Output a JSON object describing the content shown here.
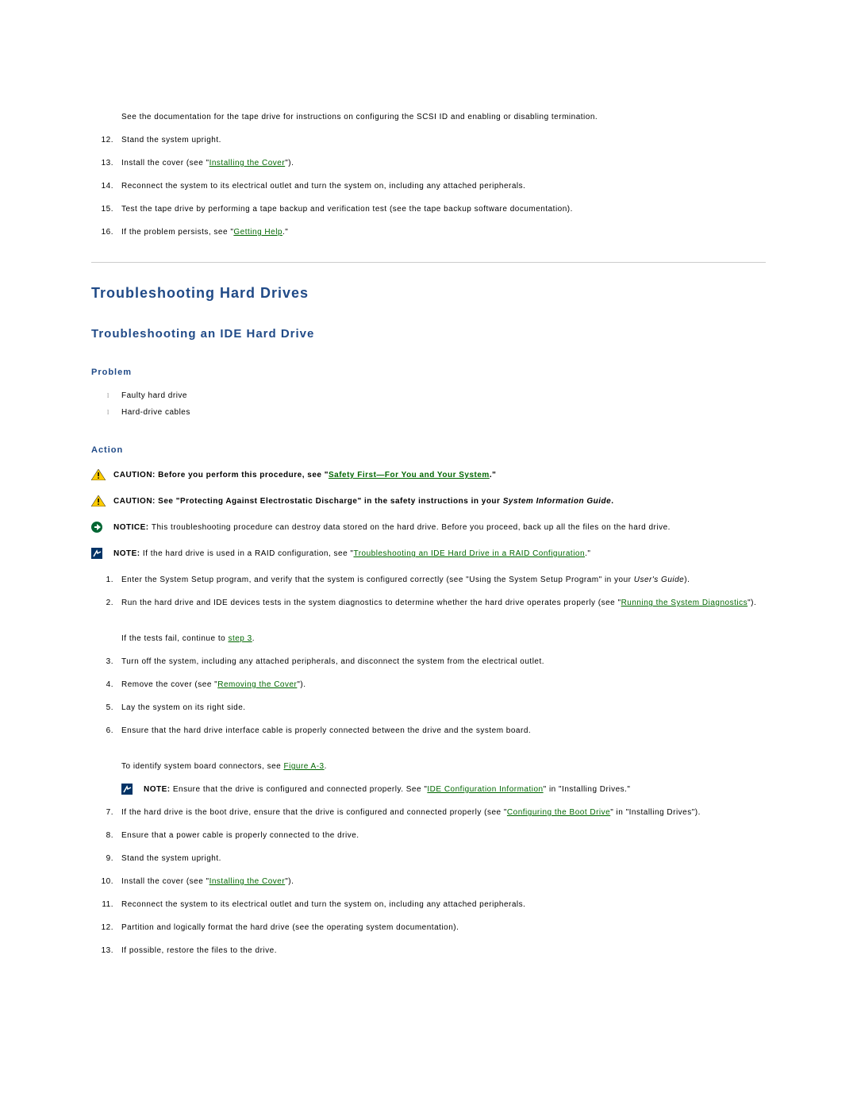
{
  "topSteps": {
    "intro": "See the documentation for the tape drive for instructions on configuring the SCSI ID and enabling or disabling termination.",
    "items": [
      {
        "n": "12.",
        "pre": "Stand the system upright."
      },
      {
        "n": "13.",
        "pre": "Install the cover (see \"",
        "link": "Installing the Cover",
        "post": "\")."
      },
      {
        "n": "14.",
        "pre": "Reconnect the system to its electrical outlet and turn the system on, including any attached peripherals."
      },
      {
        "n": "15.",
        "pre": "Test the tape drive by performing a tape backup and verification test (see the tape backup software documentation)."
      },
      {
        "n": "16.",
        "pre": "If the problem persists, see \"",
        "link": "Getting Help",
        "post": ".\""
      }
    ]
  },
  "heading1": "Troubleshooting Hard Drives",
  "heading2": "Troubleshooting an IDE Hard Drive",
  "problemHead": "Problem",
  "problemBullets": [
    "Faulty hard drive",
    "Hard-drive cables"
  ],
  "actionHead": "Action",
  "callouts": [
    {
      "icon": "triangle",
      "lead": "CAUTION: ",
      "pre": "Before you perform this procedure, see \"",
      "link": "Safety First—For You and Your System",
      "post": ".\"",
      "bold": true
    },
    {
      "icon": "triangle",
      "lead": "CAUTION: ",
      "pre": "See \"Protecting Against Electrostatic Discharge\" in the safety instructions in your ",
      "italic": "System Information Guide",
      "post": ".",
      "bold": true
    },
    {
      "icon": "circle",
      "lead": "NOTICE: ",
      "pre": "This troubleshooting procedure can destroy data stored on the hard drive. Before you proceed, back up all the files on the hard drive."
    },
    {
      "icon": "square",
      "lead": "NOTE: ",
      "pre": "If the hard drive is used in a RAID configuration, see \"",
      "link": "Troubleshooting an IDE Hard Drive in a RAID Configuration",
      "post": ".\""
    }
  ],
  "actionSteps": {
    "s1_n": "1.",
    "s1_pre": "Enter the System Setup program, and verify that the system is configured correctly (see \"Using the System Setup Program\" in your ",
    "s1_italic": "User's Guide",
    "s1_post": ").",
    "s2_n": "2.",
    "s2_pre": "Run the hard drive and IDE devices tests in the system diagnostics to determine whether the hard drive operates properly (see \"",
    "s2_link": "Running the System Diagnostics",
    "s2_post": "\").",
    "interA_pre": "If the tests fail, continue to ",
    "interA_link": "step 3",
    "interA_post": ".",
    "s3_n": "3.",
    "s3_pre": "Turn off the system, including any attached peripherals, and disconnect the system from the electrical outlet.",
    "s4_n": "4.",
    "s4_pre": "Remove the cover (see \"",
    "s4_link": "Removing the Cover",
    "s4_post": "\").",
    "s5_n": "5.",
    "s5_pre": "Lay the system on its right side.",
    "s6_n": "6.",
    "s6_pre": "Ensure that the hard drive interface cable is properly connected between the drive and the system board.",
    "interB_pre": "To identify system board connectors, see ",
    "interB_link": "Figure A-3",
    "interB_post": ".",
    "nestedNote_lead": "NOTE: ",
    "nestedNote_pre": "Ensure that the drive is configured and connected properly. See \"",
    "nestedNote_link": "IDE Configuration Information",
    "nestedNote_post": "\" in \"Installing Drives.\"",
    "s7_n": "7.",
    "s7_pre": "If the hard drive is the boot drive, ensure that the drive is configured and connected properly (see \"",
    "s7_link": "Configuring the Boot Drive",
    "s7_post": "\" in \"Installing Drives\").",
    "s8_n": "8.",
    "s8_pre": "Ensure that a power cable is properly connected to the drive.",
    "s9_n": "9.",
    "s9_pre": "Stand the system upright.",
    "s10_n": "10.",
    "s10_pre": "Install the cover (see \"",
    "s10_link": "Installing the Cover",
    "s10_post": "\").",
    "s11_n": "11.",
    "s11_pre": "Reconnect the system to its electrical outlet and turn the system on, including any attached peripherals.",
    "s12_n": "12.",
    "s12_pre": "Partition and logically format the hard drive (see the operating system documentation).",
    "s13_n": "13.",
    "s13_pre": "If possible, restore the files to the drive."
  }
}
